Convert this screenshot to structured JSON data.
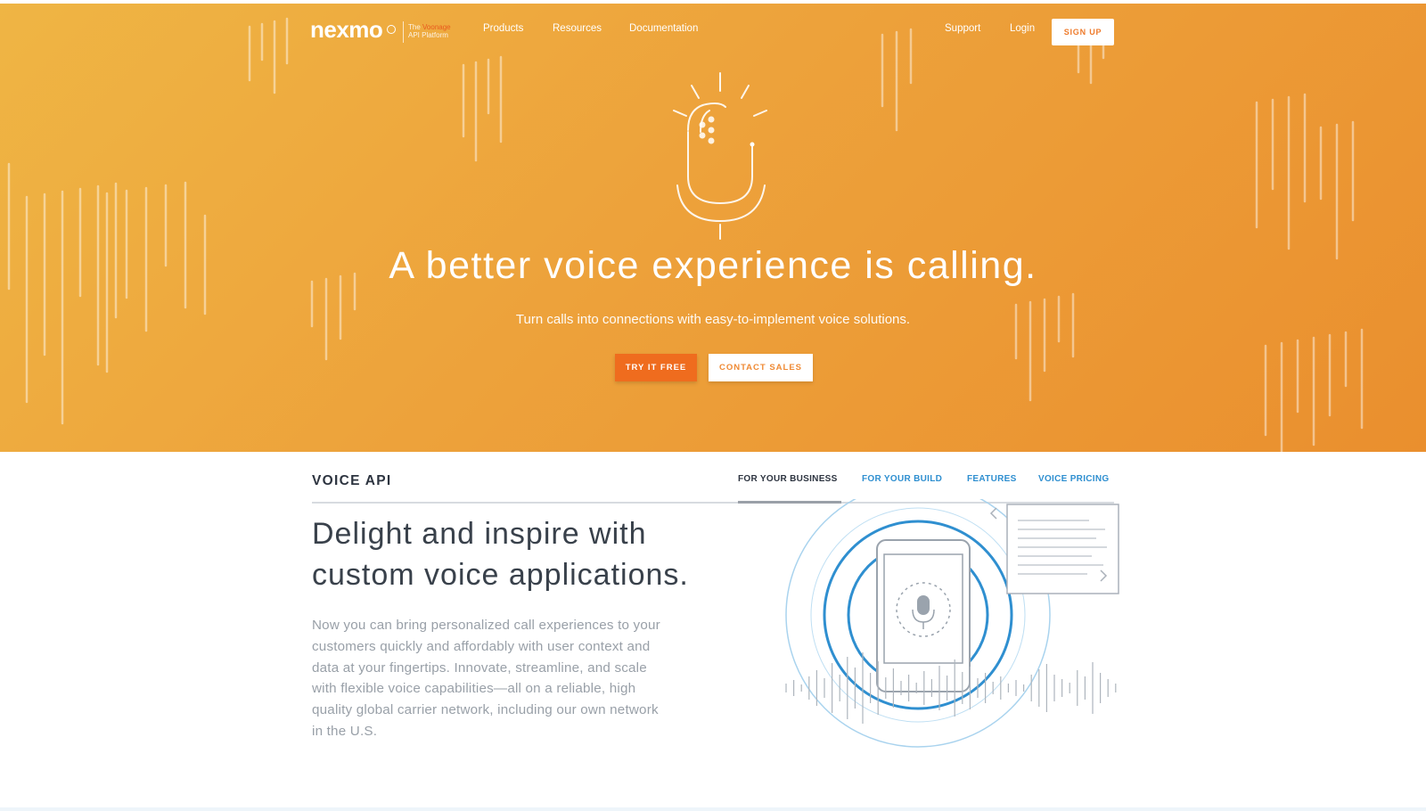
{
  "colors": {
    "hero_gradient_start": "#efb544",
    "hero_gradient_end": "#ea8f2e",
    "try_button": "#ef6c1e",
    "brand_accent": "#e85a1e",
    "link_blue": "#2f8fd0",
    "heading_dark": "#2d3440",
    "body_gray": "#99a0a8"
  },
  "nav": {
    "logo": "nexmo",
    "tagline_prefix": "The",
    "tagline_accent": "Voonage",
    "tagline_suffix": "API Platform",
    "links": {
      "products": "Products",
      "resources": "Resources",
      "documentation": "Documentation"
    },
    "support": "Support",
    "login": "Login",
    "signup": "SIGN UP"
  },
  "hero": {
    "illustration": "microphone-icon",
    "headline": "A better voice experience is calling.",
    "subheadline": "Turn calls into connections with easy-to-implement voice solutions.",
    "primary_cta": "TRY IT FREE",
    "secondary_cta": "CONTACT SALES"
  },
  "section": {
    "title": "VOICE API",
    "tabs": [
      {
        "label": "FOR YOUR BUSINESS",
        "active": true
      },
      {
        "label": "FOR YOUR BUILD",
        "active": false
      },
      {
        "label": "FEATURES",
        "active": false
      },
      {
        "label": "VOICE PRICING",
        "active": false
      }
    ]
  },
  "content": {
    "title": "Delight and inspire with\ncustom voice applications.",
    "body": "Now you can bring personalized call experiences to your customers quickly and affordably with user context and data at your fingertips. Innovate, streamline, and scale with flexible voice capabilities—all on a reliable, high quality global carrier network, including our own network in the U.S.",
    "illustration": "phone-voice-icon"
  }
}
